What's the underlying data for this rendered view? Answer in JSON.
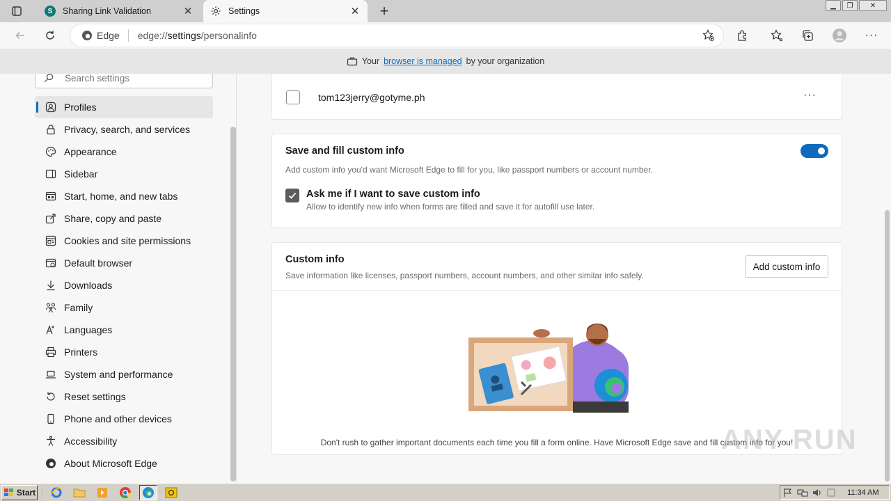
{
  "tabs": [
    {
      "title": "Sharing Link Validation",
      "icon": "sharepoint-icon",
      "active": false
    },
    {
      "title": "Settings",
      "icon": "gear-icon",
      "active": true
    }
  ],
  "address": {
    "chip": "Edge",
    "scheme": "edge://",
    "host": "settings",
    "path": "/personalinfo"
  },
  "banner": {
    "prefix": "Your",
    "link": "browser is managed",
    "suffix": "by your organization"
  },
  "search": {
    "placeholder": "Search settings"
  },
  "sidebar": {
    "items": [
      {
        "label": "Profiles",
        "icon": "profile-icon",
        "active": true
      },
      {
        "label": "Privacy, search, and services",
        "icon": "lock-icon"
      },
      {
        "label": "Appearance",
        "icon": "palette-icon"
      },
      {
        "label": "Sidebar",
        "icon": "sidebar-icon"
      },
      {
        "label": "Start, home, and new tabs",
        "icon": "home-tabs-icon"
      },
      {
        "label": "Share, copy and paste",
        "icon": "share-icon"
      },
      {
        "label": "Cookies and site permissions",
        "icon": "cookies-icon"
      },
      {
        "label": "Default browser",
        "icon": "browser-icon"
      },
      {
        "label": "Downloads",
        "icon": "download-icon"
      },
      {
        "label": "Family",
        "icon": "family-icon"
      },
      {
        "label": "Languages",
        "icon": "languages-icon"
      },
      {
        "label": "Printers",
        "icon": "printer-icon"
      },
      {
        "label": "System and performance",
        "icon": "laptop-icon"
      },
      {
        "label": "Reset settings",
        "icon": "reset-icon"
      },
      {
        "label": "Phone and other devices",
        "icon": "phone-icon"
      },
      {
        "label": "Accessibility",
        "icon": "accessibility-icon"
      },
      {
        "label": "About Microsoft Edge",
        "icon": "edge-logo-icon"
      }
    ]
  },
  "email_entry": {
    "value": "tom123jerry@gotyme.ph",
    "checked": false,
    "more": "···"
  },
  "save_custom": {
    "title": "Save and fill custom info",
    "description": "Add custom info you'd want Microsoft Edge to fill for you, like passport numbers or account number.",
    "toggle_on": true,
    "ask_title": "Ask me if I want to save custom info",
    "ask_description": "Allow to identify new info when forms are filled and save it for autofill use later.",
    "ask_checked": true
  },
  "custom_info": {
    "title": "Custom info",
    "description": "Save information like licenses, passport numbers, account numbers, and other similar info safely.",
    "add_button": "Add custom info",
    "empty_text": "Don't rush to gather important documents each time you fill a form online. Have Microsoft Edge save and fill custom info for you!"
  },
  "watermark": "ANY RUN",
  "taskbar": {
    "start": "Start",
    "clock": "11:34 AM"
  },
  "colors": {
    "accent": "#0f6cbd",
    "toggle": "#0f6cbd"
  }
}
